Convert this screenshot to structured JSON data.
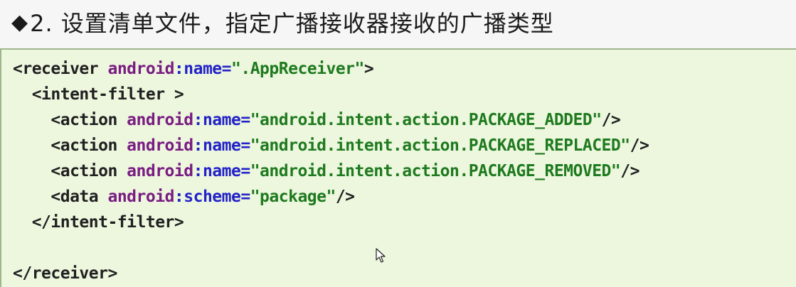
{
  "heading": {
    "bullet": "◆",
    "text": "2. 设置清单文件，指定广播接收器接收的广播类型"
  },
  "code": {
    "lines": [
      {
        "tokens": [
          {
            "t": "tag",
            "v": "<receiver "
          },
          {
            "t": "ns",
            "v": "android"
          },
          {
            "t": "attr",
            "v": ":name="
          },
          {
            "t": "val",
            "v": "\".AppReceiver\""
          },
          {
            "t": "punct",
            "v": ">"
          }
        ]
      },
      {
        "tokens": [
          {
            "t": "tag",
            "v": "  <intent-filter >"
          }
        ]
      },
      {
        "tokens": [
          {
            "t": "tag",
            "v": "    <action "
          },
          {
            "t": "ns",
            "v": "android"
          },
          {
            "t": "attr",
            "v": ":name="
          },
          {
            "t": "val",
            "v": "\"android.intent.action.PACKAGE_ADDED\""
          },
          {
            "t": "punct",
            "v": "/>"
          }
        ]
      },
      {
        "tokens": [
          {
            "t": "tag",
            "v": "    <action "
          },
          {
            "t": "ns",
            "v": "android"
          },
          {
            "t": "attr",
            "v": ":name="
          },
          {
            "t": "val",
            "v": "\"android.intent.action.PACKAGE_REPLACED\""
          },
          {
            "t": "punct",
            "v": "/>"
          }
        ]
      },
      {
        "tokens": [
          {
            "t": "tag",
            "v": "    <action "
          },
          {
            "t": "ns",
            "v": "android"
          },
          {
            "t": "attr",
            "v": ":name="
          },
          {
            "t": "val",
            "v": "\"android.intent.action.PACKAGE_REMOVED\""
          },
          {
            "t": "punct",
            "v": "/>"
          }
        ]
      },
      {
        "tokens": [
          {
            "t": "tag",
            "v": "    <data "
          },
          {
            "t": "ns",
            "v": "android"
          },
          {
            "t": "attr",
            "v": ":scheme="
          },
          {
            "t": "val",
            "v": "\"package\""
          },
          {
            "t": "punct",
            "v": "/>"
          }
        ]
      },
      {
        "tokens": [
          {
            "t": "tag",
            "v": "  </intent-filter>"
          }
        ]
      },
      {
        "tokens": [
          {
            "t": "tag",
            "v": ""
          }
        ]
      },
      {
        "tokens": [
          {
            "t": "tag",
            "v": "</receiver>"
          }
        ]
      }
    ]
  },
  "colors": {
    "background": "#f6f6f6",
    "code_background": "#ecf7de",
    "tag": "#202020",
    "namespace": "#7a1c82",
    "attribute": "#2322c7",
    "value": "#1f7a1f"
  },
  "icons": {
    "cursor": "mouse-pointer-icon"
  }
}
